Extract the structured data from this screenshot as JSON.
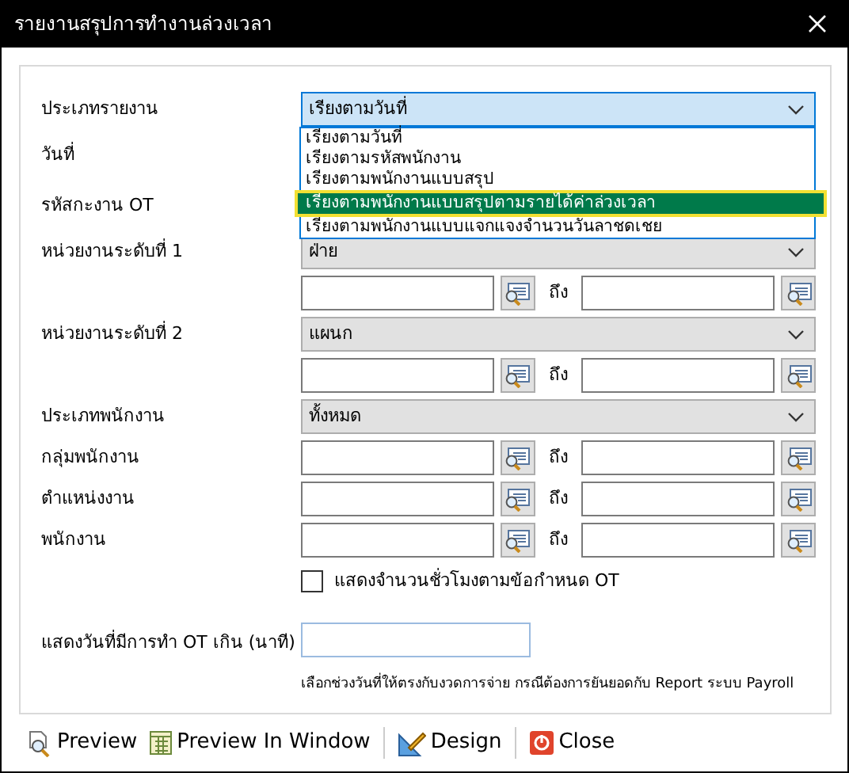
{
  "window": {
    "title": "รายงานสรุปการทำงานล่วงเวลา"
  },
  "rows": [
    {
      "kind": "select",
      "label": "ประเภทรายงาน",
      "value": "เรียงตามวันที่",
      "focused": true,
      "expanded": true,
      "options": [
        {
          "label": "เรียงตามวันที่",
          "highlighted": false
        },
        {
          "label": "เรียงตามรหัสพนักงาน",
          "highlighted": false
        },
        {
          "label": "เรียงตามพนักงานแบบสรุป",
          "highlighted": false
        },
        {
          "label": "เรียงตามพนักงานแบบสรุปตามรายได้ค่าล่วงเวลา",
          "highlighted": true
        },
        {
          "label": "เรียงตามพนักงานแบบแจกแจงจำนวนวันลาชดเชย",
          "highlighted": false
        }
      ]
    },
    {
      "kind": "covered",
      "label": "วันที่"
    },
    {
      "kind": "covered",
      "label": "รหัสกะงาน OT"
    },
    {
      "kind": "select",
      "label": "หน่วยงานระดับที่ 1",
      "value": "ฝ่าย",
      "focused": false
    },
    {
      "kind": "range",
      "to_label": "ถึง"
    },
    {
      "kind": "select",
      "label": "หน่วยงานระดับที่ 2",
      "value": "แผนก",
      "focused": false
    },
    {
      "kind": "range",
      "to_label": "ถึง"
    },
    {
      "kind": "select",
      "label": "ประเภทพนักงาน",
      "value": "ทั้งหมด",
      "focused": false
    },
    {
      "kind": "range",
      "label": "กลุ่มพนักงาน",
      "to_label": "ถึง"
    },
    {
      "kind": "range",
      "label": "ตำแหน่งงาน",
      "to_label": "ถึง"
    },
    {
      "kind": "range",
      "label": "พนักงาน",
      "to_label": "ถึง"
    },
    {
      "kind": "checkbox",
      "label": "แสดงจำนวนชั่วโมงตามข้อกำหนด OT",
      "checked": false
    },
    {
      "kind": "text",
      "label": "แสดงวันที่มีการทำ OT เกิน (นาที)"
    },
    {
      "kind": "note",
      "text": "เลือกช่วงวันที่ให้ตรงกับงวดการจ่าย กรณีต้องการยันยอดกับ Report ระบบ Payroll"
    }
  ],
  "footer_buttons": [
    {
      "kind": "preview",
      "label": "Preview"
    },
    {
      "kind": "window",
      "label": "Preview In Window"
    },
    {
      "kind": "design",
      "label": "Design"
    },
    {
      "kind": "close",
      "label": "Close"
    }
  ]
}
